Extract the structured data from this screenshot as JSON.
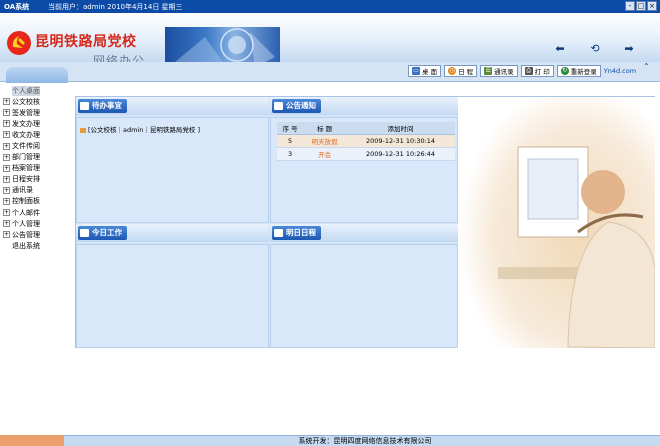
{
  "titlebar": {
    "app_title": "OA系统",
    "user_info": "当前用户：admin 2010年4月14日 星期三",
    "window_buttons": [
      "-",
      "□",
      "×"
    ]
  },
  "banner": {
    "org_name": "昆明铁路局党校",
    "subtitle": "网络办公",
    "nav_icons": [
      "back-arrow-icon",
      "refresh-icon",
      "forward-arrow-icon"
    ]
  },
  "toolbar": {
    "buttons": [
      {
        "label": "桌 面",
        "icon": "desktop-icon",
        "color": "#3a6fc4"
      },
      {
        "label": "日 程",
        "icon": "schedule-icon",
        "color": "#e08a1e"
      },
      {
        "label": "通讯录",
        "icon": "contacts-icon",
        "color": "#5a8a3a"
      },
      {
        "label": "打 印",
        "icon": "print-icon",
        "color": "#555555"
      },
      {
        "label": "重新登录",
        "icon": "relogin-icon",
        "color": "#2b8a3e"
      }
    ],
    "brand": "Yn4d.com"
  },
  "sidebar": {
    "items": [
      {
        "label": "个人桌面",
        "selected": true,
        "expandable": false
      },
      {
        "label": "公文校核",
        "expandable": true
      },
      {
        "label": "签发管理",
        "expandable": true
      },
      {
        "label": "发文办理",
        "expandable": true
      },
      {
        "label": "收文办理",
        "expandable": true
      },
      {
        "label": "文件传阅",
        "expandable": true
      },
      {
        "label": "部门管理",
        "expandable": true
      },
      {
        "label": "档案管理",
        "expandable": true
      },
      {
        "label": "日程安排",
        "expandable": true
      },
      {
        "label": "通讯录",
        "expandable": true
      },
      {
        "label": "控制面板",
        "expandable": true
      },
      {
        "label": "个人邮件",
        "expandable": true
      },
      {
        "label": "个人管理",
        "expandable": true
      },
      {
        "label": "公告管理",
        "expandable": true
      },
      {
        "label": "退出系统",
        "expandable": false
      }
    ]
  },
  "panels": {
    "todo": {
      "title": "待办事宜",
      "item": "[公文校核｜admin｜昆明铁路局党校 ]"
    },
    "notices": {
      "title": "公告通知",
      "columns": [
        "序 号",
        "标 题",
        "添加时间"
      ],
      "rows": [
        {
          "no": "5",
          "title": "明天放假",
          "time": "2009-12-31 10:30:14"
        },
        {
          "no": "3",
          "title": "开会",
          "time": "2009-12-31 10:26:44"
        }
      ]
    },
    "today": {
      "title": "今日工作"
    },
    "tomorrow": {
      "title": "明日日程"
    }
  },
  "footer": {
    "text": "系统开发：昆明四度网络信息技术有限公司"
  }
}
